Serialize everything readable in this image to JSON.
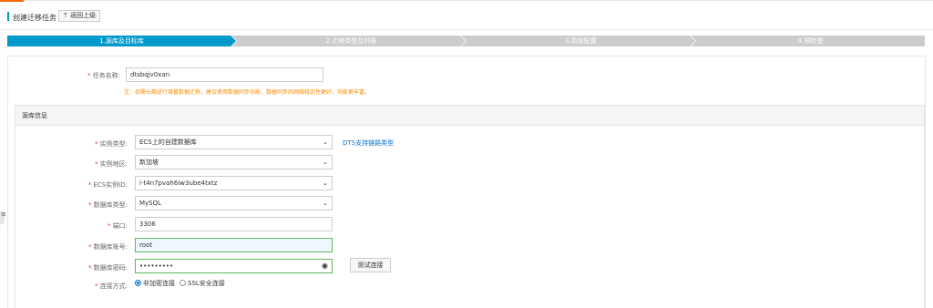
{
  "header": {
    "title": "创建迁移任务",
    "back_label": "返回上级",
    "back_icon": "up-arrow-icon"
  },
  "steps": [
    {
      "label": "1.源库及目标库",
      "active": true
    },
    {
      "label": "2.迁移类型及列表",
      "active": false
    },
    {
      "label": "3.高级配置",
      "active": false
    },
    {
      "label": "4.预检查",
      "active": false
    }
  ],
  "colors": {
    "step_active": "#0099cc",
    "step_inactive": "#cccccc",
    "required": "#e4393c",
    "note": "#ff8a00",
    "link": "#0070cc",
    "accent_top": "#ff6a00"
  },
  "task": {
    "name_label": "任务名称:",
    "name_value": "dtsbqjv0xan",
    "note": "注：如需长期进行增量数据迁移，建议使用数据同步功能，数据同步的网络稳定性更好，功能更丰富。"
  },
  "source": {
    "section_title": "源库信息",
    "instance_type_label": "实例类型:",
    "instance_type_value": "ECS上的自建数据库",
    "dts_link": "DTS支持链路类型",
    "region_label": "实例地区:",
    "region_value": "新加坡",
    "ecs_label": "ECS实例ID:",
    "ecs_value": "i-t4n7pvah6iw3ube4txtz",
    "db_type_label": "数据库类型:",
    "db_type_value": "MySQL",
    "port_label": "端口:",
    "port_value": "3306",
    "account_label": "数据库账号:",
    "account_value": "root",
    "password_label": "数据库密码:",
    "password_value": "•••••••••",
    "password_icon": "eye-icon",
    "test_button": "测试连接",
    "conn_label": "连接方式:",
    "conn_option_1": "非加密连接",
    "conn_option_2": "SSL安全连接",
    "conn_selected": "非加密连接"
  }
}
